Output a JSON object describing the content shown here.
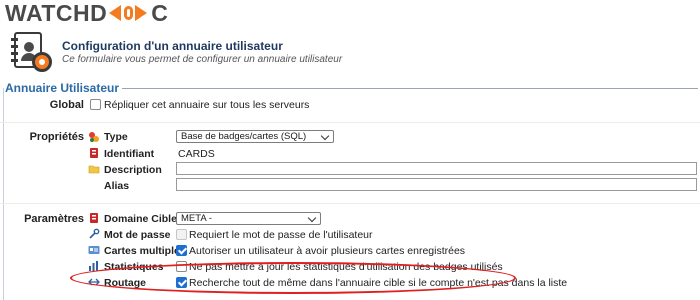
{
  "brand": {
    "logo_left": "WATCHD",
    "logo_right": "C"
  },
  "page": {
    "title": "Configuration d'un annuaire utilisateur",
    "subtitle": "Ce formulaire vous permet de configurer un annuaire utilisateur"
  },
  "section": {
    "legend": "Annuaire Utilisateur"
  },
  "global": {
    "label": "Global",
    "replicate_label": "Répliquer cet annuaire sur tous les serveurs",
    "replicate_checked": false
  },
  "properties": {
    "label": "Propriétés",
    "type": {
      "label": "Type",
      "value": "Base de badges/cartes (SQL)"
    },
    "identifier": {
      "label": "Identifiant",
      "value": "CARDS"
    },
    "description": {
      "label": "Description",
      "value": ""
    },
    "alias": {
      "label": "Alias",
      "value": ""
    }
  },
  "parameters": {
    "label": "Paramètres",
    "target_domain": {
      "label": "Domaine Cible",
      "value": "META -"
    },
    "password": {
      "label": "Mot de passe",
      "option": "Requiert le mot de passe de l'utilisateur",
      "checked": false,
      "disabled": true
    },
    "multi_cards": {
      "label": "Cartes multiples",
      "option": "Autoriser un utilisateur à avoir plusieurs cartes enregistrées",
      "checked": true
    },
    "statistics": {
      "label": "Statistiques",
      "option": "Ne pas mettre à jour les statistiques d'utilisation des badges utilisés",
      "checked": false
    },
    "routing": {
      "label": "Routage",
      "option": "Recherche tout de même dans l'annuaire cible si le compte n'est pas dans la liste",
      "checked": true
    }
  },
  "colors": {
    "brand_orange": "#f47b20",
    "legend_blue": "#2b6aa6",
    "checkbox_blue": "#1e6fd0",
    "highlight_red": "#e02020"
  },
  "icons": [
    "watchdoc-logo",
    "directory-settings-icon",
    "type-icon",
    "identifier-icon",
    "description-icon",
    "target-domain-icon",
    "password-icon",
    "cards-icon",
    "statistics-icon",
    "routing-icon"
  ]
}
